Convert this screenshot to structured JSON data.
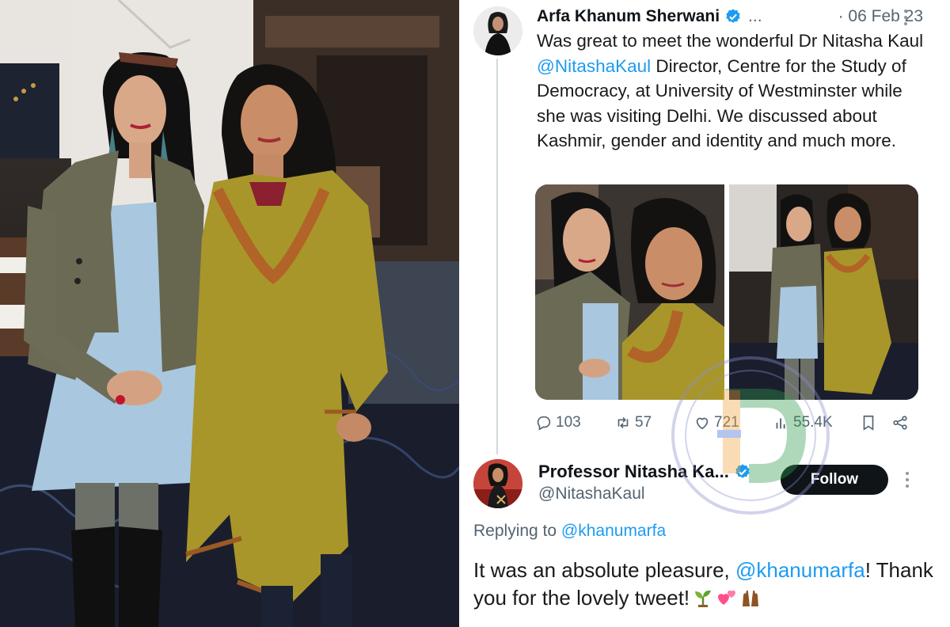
{
  "tweet": {
    "author_name": "Arfa Khanum Sherwani",
    "author_handle_truncated": "...",
    "date_separator": "·",
    "date": "06 Feb 23",
    "text_segments": [
      {
        "text": "Was great to meet the wonderful Dr Nitasha Kaul ",
        "type": "text"
      },
      {
        "text": "@NitashaKaul",
        "type": "mention"
      },
      {
        "text": " Director, Centre for the Study of Democracy, at University of Westminster while she was visiting Delhi. We discussed about Kashmir, gender and identity and much more.",
        "type": "text"
      }
    ],
    "media_count": 2,
    "actions": {
      "replies": "103",
      "retweets": "57",
      "likes": "721",
      "views": "55.4K"
    },
    "icons": [
      "reply-icon",
      "retweet-icon",
      "like-icon",
      "views-icon",
      "bookmark-icon",
      "share-icon",
      "more-icon",
      "verified-badge-icon"
    ]
  },
  "reply": {
    "author_name": "Professor Nitasha Ka...",
    "author_handle": "@NitashaKaul",
    "follow_label": "Follow",
    "replying_to_label": "Replying to",
    "replying_to_handle": "@khanumarfa",
    "text_start": "It was an absolute pleasure, ",
    "text_mention": "@khanumarfa",
    "text_end": "! Thank you for the lovely tweet!",
    "emojis": [
      "seedling-emoji",
      "two-hearts-emoji",
      "raising-hands-emoji"
    ]
  },
  "colors": {
    "mention_blue": "#1d9bf0",
    "verified_blue": "#1d9bf0",
    "muted_gray": "#536471",
    "follow_bg": "#0f1419",
    "kurta_mustard": "#a8962a",
    "denim": "#a9c7de",
    "jacket_olive": "#6b6a55"
  }
}
